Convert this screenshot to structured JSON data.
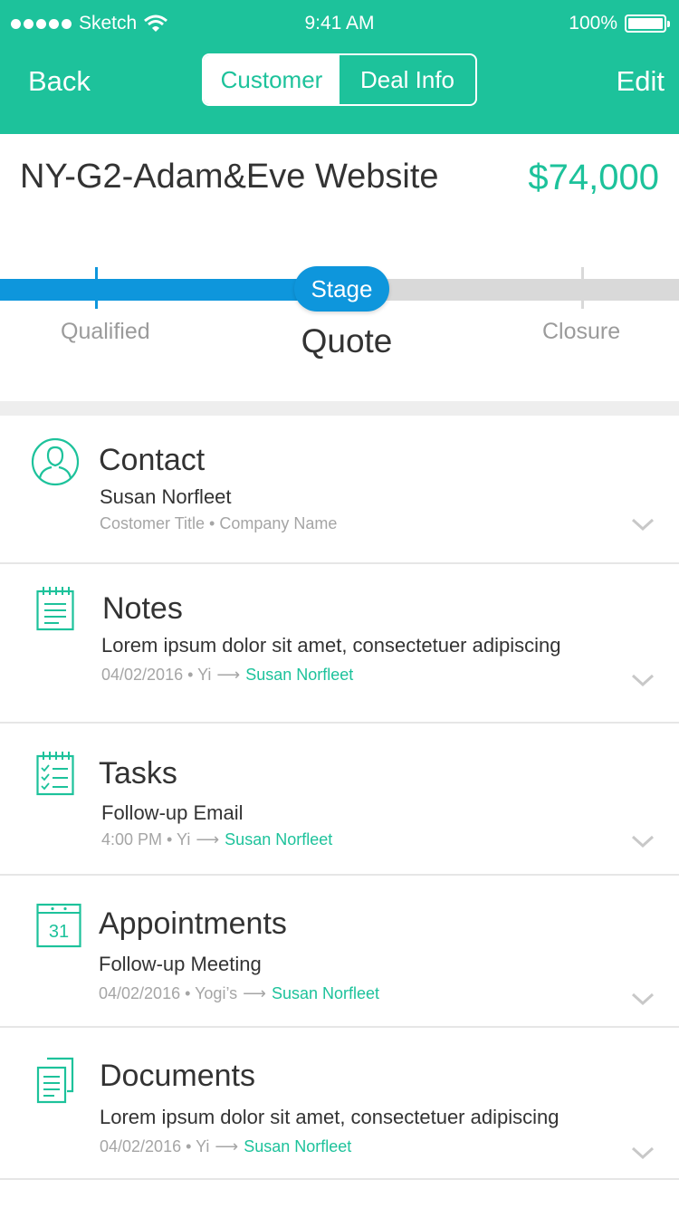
{
  "status_bar": {
    "carrier": "Sketch",
    "time": "9:41 AM",
    "battery": "100%"
  },
  "nav": {
    "back_label": "Back",
    "edit_label": "Edit",
    "segments": [
      "Customer",
      "Deal Info"
    ]
  },
  "deal": {
    "title": "NY-G2-Adam&Eve Website",
    "amount": "$74,000"
  },
  "stage": {
    "badge": "Stage",
    "current": "Quote",
    "left_label": "Qualified",
    "right_label": "Closure",
    "progress": 0.55
  },
  "colors": {
    "accent": "#1dc29b",
    "stage_blue": "#0e96dc",
    "track": "#d9d9d9"
  },
  "sections": {
    "contact": {
      "icon": "person-icon",
      "title": "Contact",
      "line1": "Susan Norfleet",
      "line2": "Costomer Title • Company Name"
    },
    "notes": {
      "icon": "notepad-icon",
      "title": "Notes",
      "line1": "Lorem ipsum dolor sit amet, consectetuer adipiscing",
      "meta": "04/02/2016 • Yi",
      "person": "Susan Norfleet"
    },
    "tasks": {
      "icon": "checklist-icon",
      "title": "Tasks",
      "line1": "Follow-up Email",
      "meta": "4:00 PM • Yi",
      "person": "Susan Norfleet"
    },
    "appointments": {
      "icon": "calendar-icon",
      "title": "Appointments",
      "calendar_day": "31",
      "line1": "Follow-up Meeting",
      "meta": "04/02/2016 • Yogi’s",
      "person": "Susan Norfleet"
    },
    "documents": {
      "icon": "documents-icon",
      "title": "Documents",
      "line1": "Lorem ipsum dolor sit amet, consectetuer adipiscing",
      "meta": "04/02/2016 • Yi",
      "person": "Susan Norfleet"
    }
  }
}
